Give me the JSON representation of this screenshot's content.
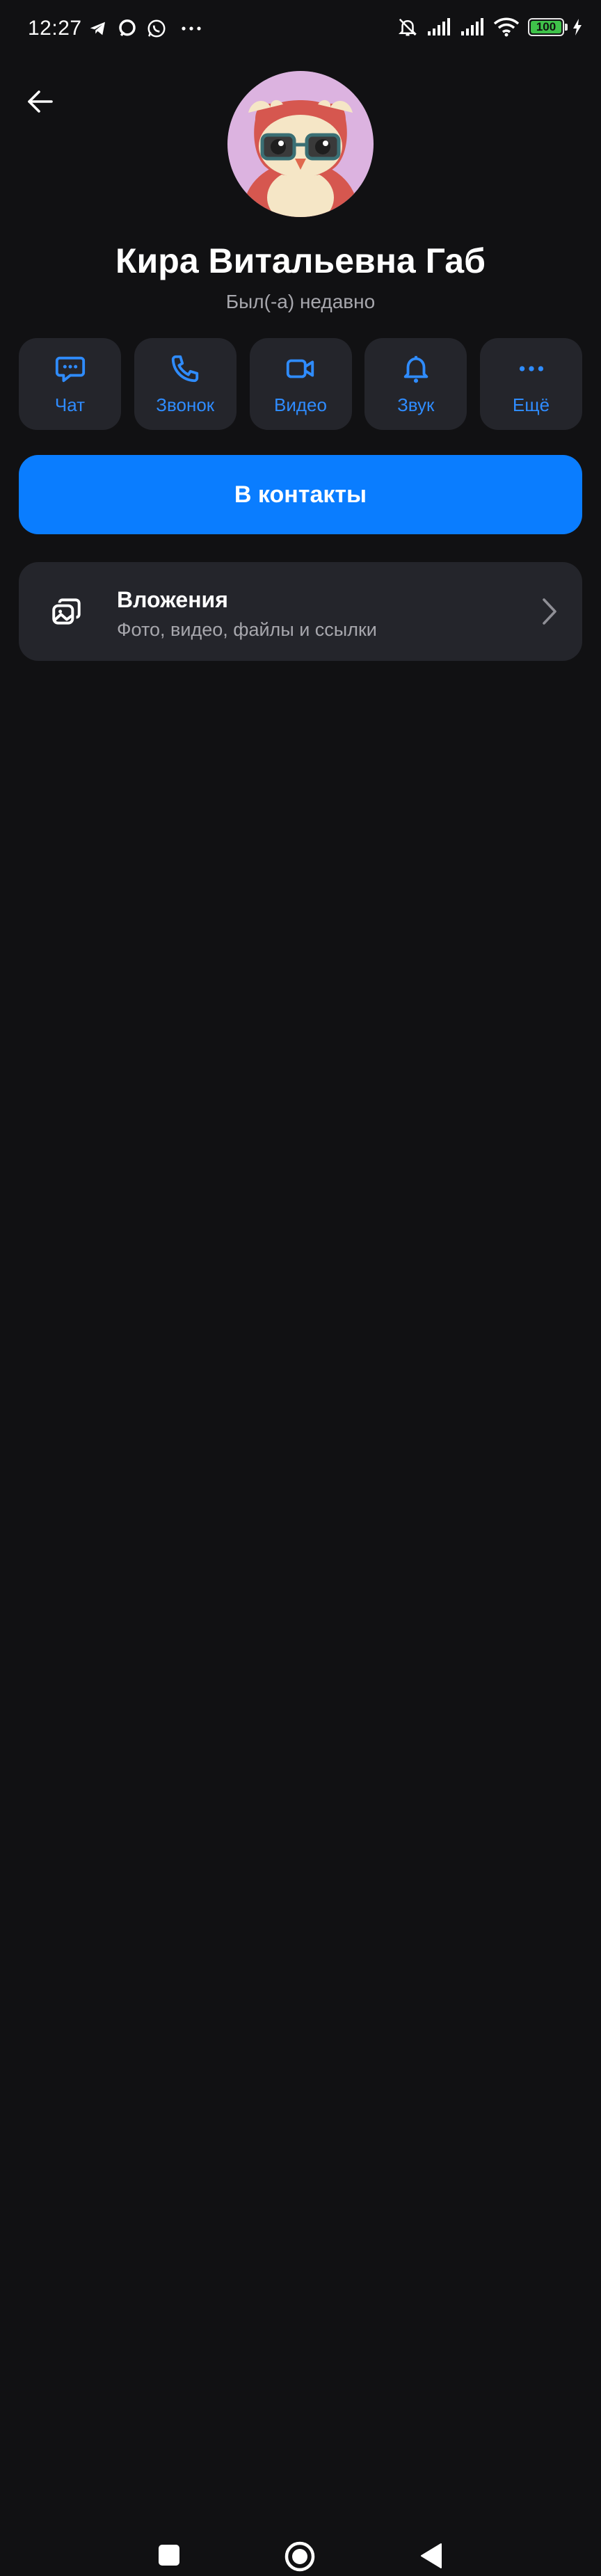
{
  "status_bar": {
    "time": "12:27",
    "battery_level": "100",
    "battery_percent": 100,
    "left_icons": [
      "telegram-icon",
      "chat-bubble-icon",
      "whatsapp-icon",
      "more-dots-icon"
    ],
    "right_icons": [
      "bell-off-icon",
      "signal-icon",
      "signal-icon",
      "wifi-icon",
      "battery-icon",
      "charging-icon"
    ]
  },
  "profile": {
    "name": "Кира Витальевна Габ",
    "last_seen": "Был(-а) недавно"
  },
  "actions": [
    {
      "label": "Чат",
      "icon": "chat-icon"
    },
    {
      "label": "Звонок",
      "icon": "phone-icon"
    },
    {
      "label": "Видео",
      "icon": "video-icon"
    },
    {
      "label": "Звук",
      "icon": "bell-icon"
    },
    {
      "label": "Ещё",
      "icon": "more-icon"
    }
  ],
  "add_contact_label": "В контакты",
  "attachments": {
    "title": "Вложения",
    "subtitle": "Фото, видео, файлы и ссылки"
  },
  "colors": {
    "background": "#111113",
    "card": "#24252b",
    "accent": "#0a7dff",
    "accent_text": "#2f8cff",
    "secondary_text": "#a7a7ad"
  }
}
